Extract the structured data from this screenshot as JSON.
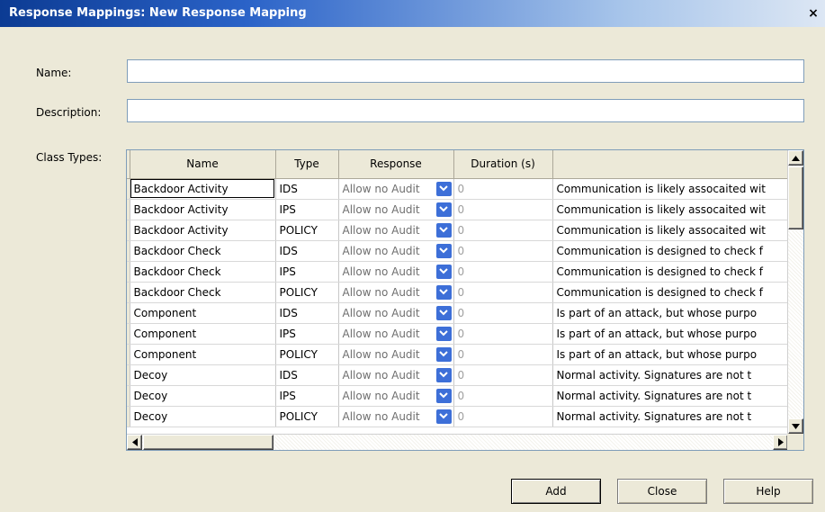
{
  "window": {
    "title": "Response Mappings: New Response Mapping",
    "close_glyph": "×"
  },
  "form": {
    "name_label": "Name:",
    "name_value": "",
    "description_label": "Description:",
    "description_value": "",
    "class_types_label": "Class Types:"
  },
  "grid": {
    "columns": [
      "Name",
      "Type",
      "Response",
      "Duration (s)",
      ""
    ],
    "rows": [
      {
        "name": "Backdoor Activity",
        "type": "IDS",
        "response": "Allow no Audit",
        "duration": "0",
        "description": "Communication is likely assocaited wit"
      },
      {
        "name": "Backdoor Activity",
        "type": "IPS",
        "response": "Allow no Audit",
        "duration": "0",
        "description": "Communication is likely assocaited wit"
      },
      {
        "name": "Backdoor Activity",
        "type": "POLICY",
        "response": "Allow no Audit",
        "duration": "0",
        "description": "Communication is likely assocaited wit"
      },
      {
        "name": "Backdoor Check",
        "type": "IDS",
        "response": "Allow no Audit",
        "duration": "0",
        "description": "Communication is designed to check f"
      },
      {
        "name": "Backdoor Check",
        "type": "IPS",
        "response": "Allow no Audit",
        "duration": "0",
        "description": "Communication is designed to check f"
      },
      {
        "name": "Backdoor Check",
        "type": "POLICY",
        "response": "Allow no Audit",
        "duration": "0",
        "description": "Communication is designed to check f"
      },
      {
        "name": "Component",
        "type": "IDS",
        "response": "Allow no Audit",
        "duration": "0",
        "description": "Is part of an attack, but whose purpo"
      },
      {
        "name": "Component",
        "type": "IPS",
        "response": "Allow no Audit",
        "duration": "0",
        "description": "Is part of an attack, but whose purpo"
      },
      {
        "name": "Component",
        "type": "POLICY",
        "response": "Allow no Audit",
        "duration": "0",
        "description": "Is part of an attack, but whose purpo"
      },
      {
        "name": "Decoy",
        "type": "IDS",
        "response": "Allow no Audit",
        "duration": "0",
        "description": "Normal activity.  Signatures are not t"
      },
      {
        "name": "Decoy",
        "type": "IPS",
        "response": "Allow no Audit",
        "duration": "0",
        "description": "Normal activity.  Signatures are not t"
      },
      {
        "name": "Decoy",
        "type": "POLICY",
        "response": "Allow no Audit",
        "duration": "0",
        "description": "Normal activity.  Signatures are not t"
      }
    ]
  },
  "buttons": {
    "add": "Add",
    "close": "Close",
    "help": "Help"
  },
  "icons": {
    "dropdown": "chevron-down-icon",
    "scroll_up": "arrow-up-icon",
    "scroll_down": "arrow-down-icon",
    "scroll_left": "arrow-left-icon",
    "scroll_right": "arrow-right-icon"
  },
  "colors": {
    "accent": "#3d6fd8",
    "title_bar": "#0c3b93",
    "dialog_bg": "#ece9d8"
  }
}
